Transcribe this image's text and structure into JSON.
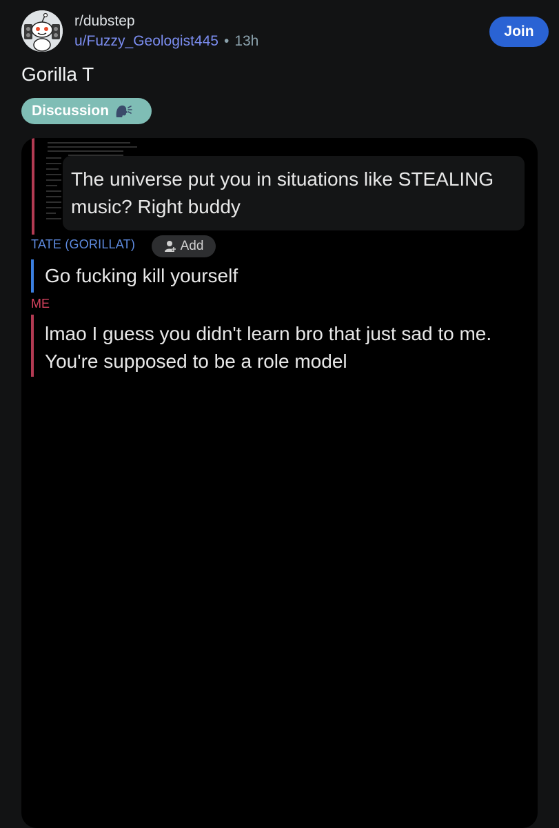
{
  "header": {
    "subreddit": "r/dubstep",
    "username": "u/Fuzzy_Geologist445",
    "separator": "•",
    "age": "13h",
    "join_label": "Join"
  },
  "post": {
    "title": "Gorilla T",
    "flair": {
      "label": "Discussion",
      "icon": "speaking-head-icon",
      "color": "#7fbdb5"
    }
  },
  "image_content": {
    "quoted_message": "The universe put you in situations like STEALING music? Right buddy",
    "tate_sender": "TATE (GORILLAT)",
    "add_label": "Add",
    "tate_message": "Go fucking kill yourself",
    "me_sender": "ME",
    "me_message": "lmao I guess you didn't learn bro that just sad to me. You're supposed to be a role model"
  },
  "colors": {
    "background": "#121314",
    "join_button": "#2a63d4",
    "username": "#7b8df0",
    "tate_color": "#5e8be0",
    "me_color": "#d6425e"
  }
}
